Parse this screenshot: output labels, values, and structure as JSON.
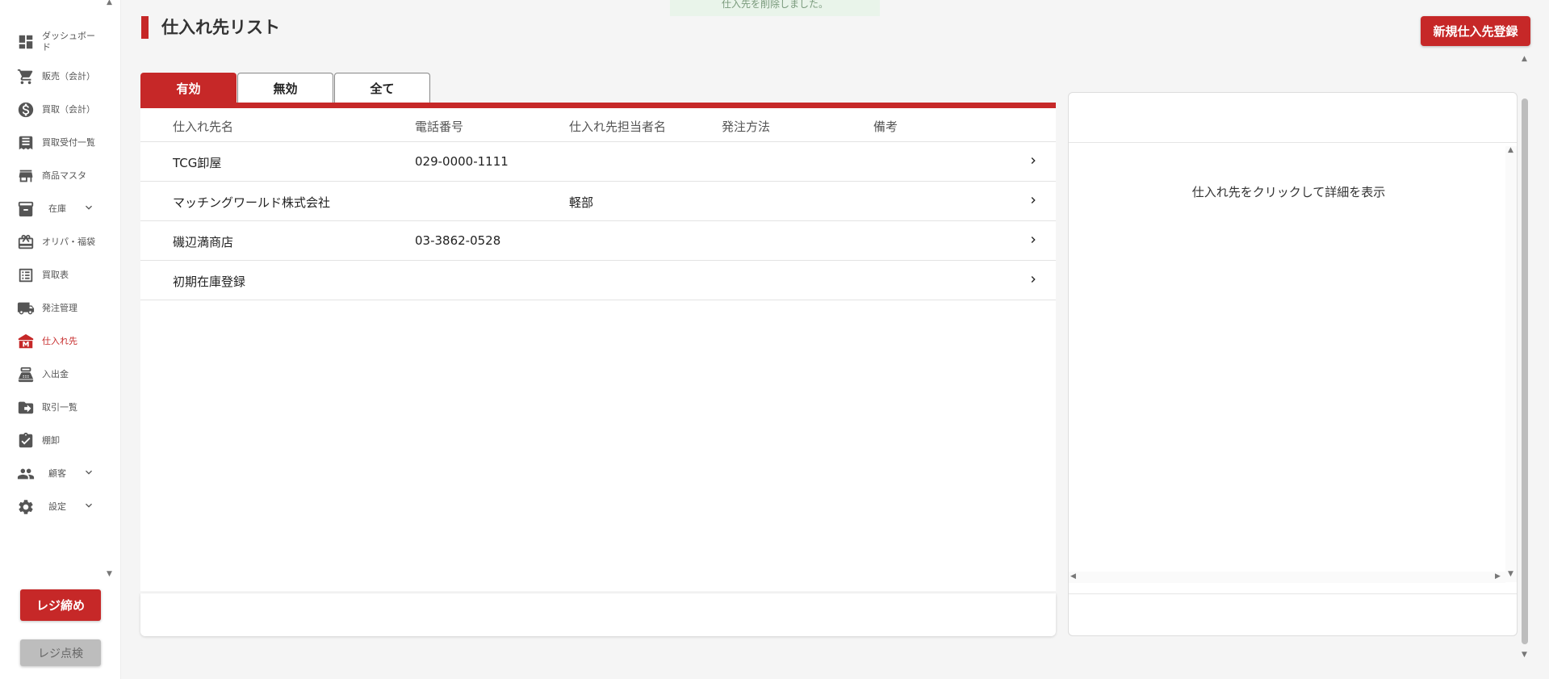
{
  "toast": {
    "message": "仕入先を削除しました。"
  },
  "sidebar": {
    "items": [
      {
        "label": "ダッシュボード",
        "icon": "dashboard-icon"
      },
      {
        "label": "販売（会計）",
        "icon": "cart-icon"
      },
      {
        "label": "買取（会計）",
        "icon": "dollar-icon"
      },
      {
        "label": "買取受付一覧",
        "icon": "receipt-icon"
      },
      {
        "label": "商品マスタ",
        "icon": "store-icon"
      },
      {
        "label": "在庫",
        "icon": "inventory-icon"
      },
      {
        "label": "オリパ・福袋",
        "icon": "gift-icon"
      },
      {
        "label": "買取表",
        "icon": "list-icon"
      },
      {
        "label": "発注管理",
        "icon": "truck-icon"
      },
      {
        "label": "仕入れ先",
        "icon": "supplier-icon"
      },
      {
        "label": "入出金",
        "icon": "register-icon"
      },
      {
        "label": "取引一覧",
        "icon": "folder-arrow-icon"
      },
      {
        "label": "棚卸",
        "icon": "clipboard-check-icon"
      },
      {
        "label": "顧客",
        "icon": "people-icon"
      },
      {
        "label": "設定",
        "icon": "gear-icon"
      }
    ],
    "close_register_label": "レジ締め",
    "check_register_label": "レジ点検"
  },
  "header": {
    "title": "仕入れ先リスト",
    "new_supplier_label": "新規仕入先登録"
  },
  "tabs": [
    {
      "label": "有効"
    },
    {
      "label": "無効"
    },
    {
      "label": "全て"
    }
  ],
  "table": {
    "columns": [
      "仕入れ先名",
      "電話番号",
      "仕入れ先担当者名",
      "発注方法",
      "備考"
    ],
    "rows": [
      {
        "name": "TCG卸屋",
        "phone": "029-0000-1111",
        "contact": "",
        "method": "",
        "note": ""
      },
      {
        "name": "マッチングワールド株式会社",
        "phone": "",
        "contact": "軽部",
        "method": "",
        "note": ""
      },
      {
        "name": "磯辺満商店",
        "phone": "03-3862-0528",
        "contact": "",
        "method": "",
        "note": ""
      },
      {
        "name": "初期在庫登録",
        "phone": "",
        "contact": "",
        "method": "",
        "note": ""
      }
    ]
  },
  "detail": {
    "placeholder": "仕入れ先をクリックして詳細を表示"
  },
  "colors": {
    "accent": "#c62828",
    "active_nav": "#c62828"
  }
}
